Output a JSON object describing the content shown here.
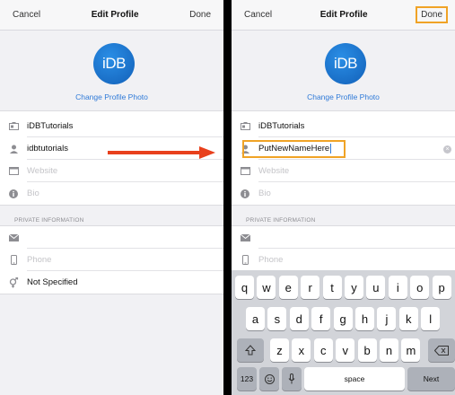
{
  "left": {
    "nav": {
      "cancel": "Cancel",
      "title": "Edit Profile",
      "done": "Done"
    },
    "change_photo": "Change Profile Photo",
    "avatar_text": "iDB",
    "name": "iDBTutorials",
    "username": "idbtutorials",
    "website_placeholder": "Website",
    "bio_placeholder": "Bio",
    "private_header": "PRIVATE INFORMATION",
    "phone_placeholder": "Phone",
    "gender": "Not Specified"
  },
  "right": {
    "nav": {
      "cancel": "Cancel",
      "title": "Edit Profile",
      "done": "Done"
    },
    "change_photo": "Change Profile Photo",
    "avatar_text": "iDB",
    "name": "iDBTutorials",
    "username": "PutNewNameHere",
    "website_placeholder": "Website",
    "bio_placeholder": "Bio",
    "private_header": "PRIVATE INFORMATION",
    "phone_placeholder": "Phone"
  },
  "keyboard": {
    "row1": [
      "q",
      "w",
      "e",
      "r",
      "t",
      "y",
      "u",
      "i",
      "o",
      "p"
    ],
    "row2": [
      "a",
      "s",
      "d",
      "f",
      "g",
      "h",
      "j",
      "k",
      "l"
    ],
    "row3": [
      "z",
      "x",
      "c",
      "v",
      "b",
      "n",
      "m"
    ],
    "numbers": "123",
    "space": "space",
    "next": "Next"
  },
  "colors": {
    "highlight": "#f0a326",
    "arrow": "#e8401c",
    "link": "#2f7ad8"
  }
}
